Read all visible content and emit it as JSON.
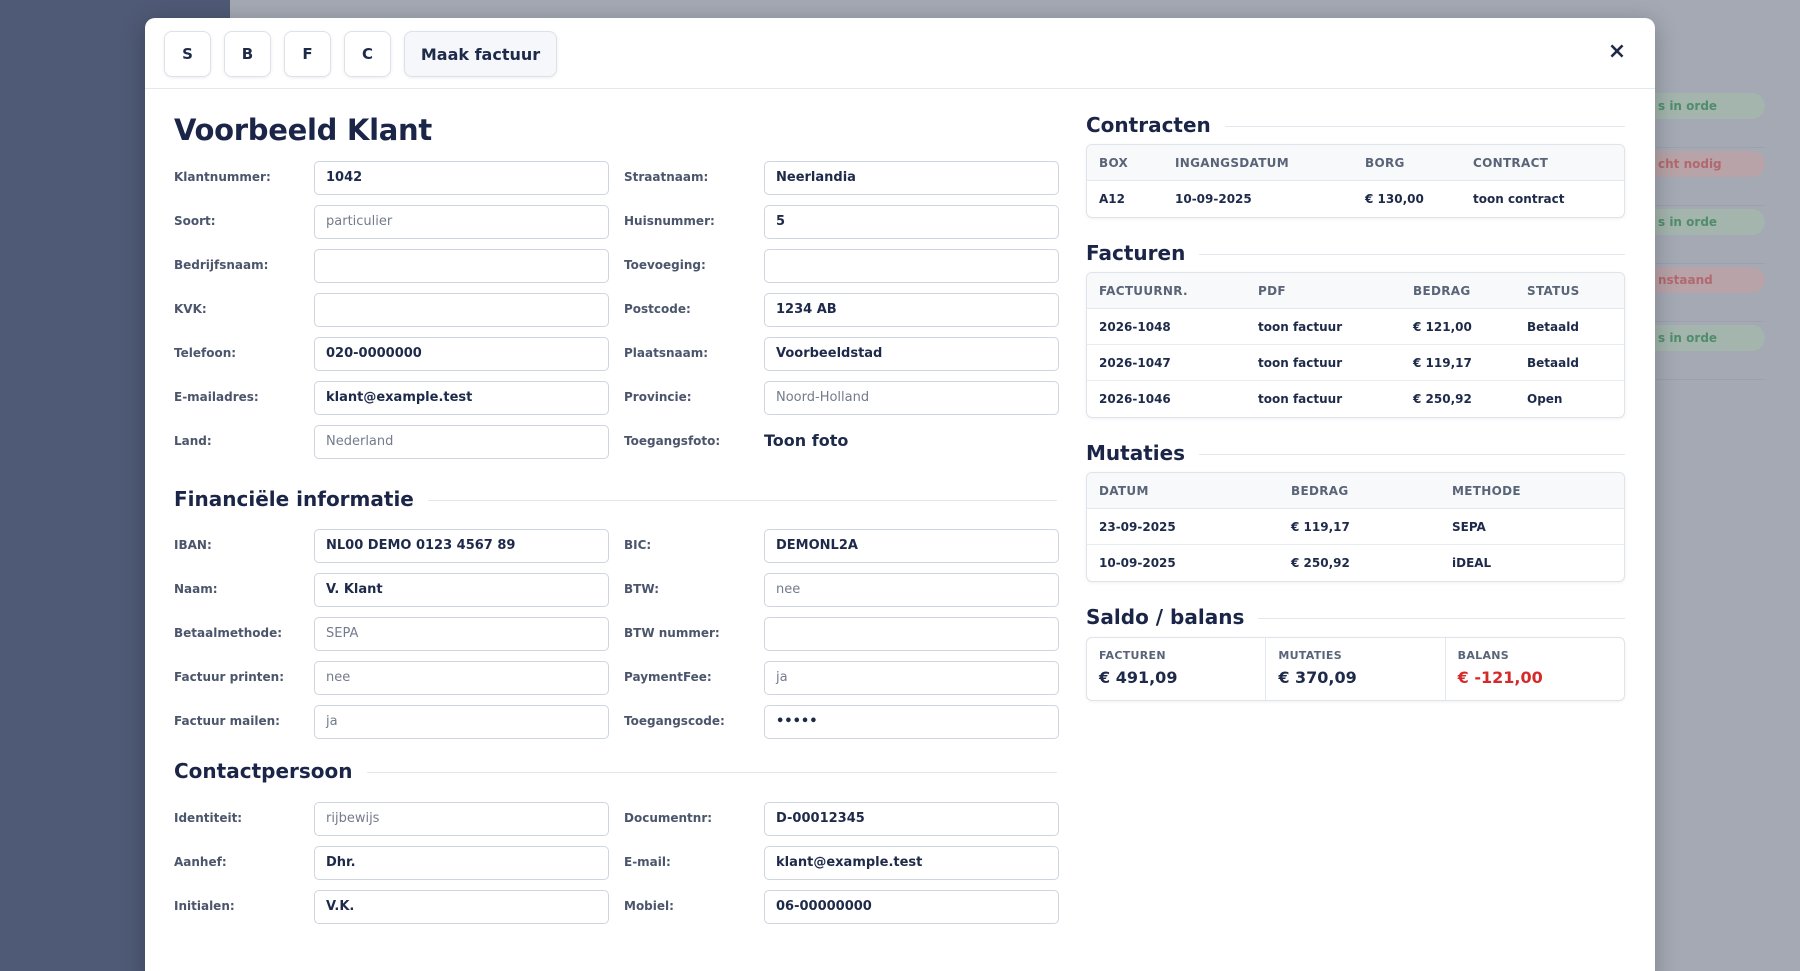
{
  "background": {
    "status_pills": [
      {
        "text": "s in orde",
        "status": "green"
      },
      {
        "text": "cht nodig",
        "status": "red"
      },
      {
        "text": "s in orde",
        "status": "green"
      },
      {
        "text": "nstaand",
        "status": "red"
      },
      {
        "text": "s in orde",
        "status": "green"
      }
    ]
  },
  "toolbar": {
    "buttons": [
      "S",
      "B",
      "F",
      "C"
    ],
    "invoice_button": "Maak factuur",
    "close": "×"
  },
  "customer": {
    "name": "Voorbeeld Klant",
    "fields_left": [
      {
        "label": "Klantnummer:",
        "value": "1042",
        "placeholder": false
      },
      {
        "label": "Soort:",
        "value": "particulier",
        "placeholder": true
      },
      {
        "label": "Bedrijfsnaam:",
        "value": "",
        "placeholder": false
      },
      {
        "label": "KVK:",
        "value": "",
        "placeholder": false
      },
      {
        "label": "Telefoon:",
        "value": "020-0000000",
        "placeholder": false
      },
      {
        "label": "E-mailadres:",
        "value": "klant@example.test",
        "placeholder": false
      },
      {
        "label": "Land:",
        "value": "Nederland",
        "placeholder": true
      }
    ],
    "fields_right": [
      {
        "label": "Straatnaam:",
        "value": "Neerlandia",
        "placeholder": false
      },
      {
        "label": "Huisnummer:",
        "value": "5",
        "placeholder": false
      },
      {
        "label": "Toevoeging:",
        "value": "",
        "placeholder": false
      },
      {
        "label": "Postcode:",
        "value": "1234 AB",
        "placeholder": false
      },
      {
        "label": "Plaatsnaam:",
        "value": "Voorbeeldstad",
        "placeholder": false
      },
      {
        "label": "Provincie:",
        "value": "Noord-Holland",
        "placeholder": true
      },
      {
        "label": "Toegangsfoto:",
        "value": "Toon foto",
        "plain": true
      }
    ]
  },
  "financial": {
    "title": "Financiële informatie",
    "fields_left": [
      {
        "label": "IBAN:",
        "value": "NL00 DEMO 0123 4567 89",
        "placeholder": false
      },
      {
        "label": "Naam:",
        "value": "V. Klant",
        "placeholder": false
      },
      {
        "label": "Betaalmethode:",
        "value": "SEPA",
        "placeholder": true
      },
      {
        "label": "Factuur printen:",
        "value": "nee",
        "placeholder": true
      },
      {
        "label": "Factuur mailen:",
        "value": "ja",
        "placeholder": true
      }
    ],
    "fields_right": [
      {
        "label": "BIC:",
        "value": "DEMONL2A",
        "placeholder": false
      },
      {
        "label": "BTW:",
        "value": "nee",
        "placeholder": true
      },
      {
        "label": "BTW nummer:",
        "value": "",
        "placeholder": false
      },
      {
        "label": "PaymentFee:",
        "value": "ja",
        "placeholder": true
      },
      {
        "label": "Toegangscode:",
        "value": "•••••",
        "placeholder": false
      }
    ]
  },
  "contact": {
    "title": "Contactpersoon",
    "fields_left": [
      {
        "label": "Identiteit:",
        "value": "rijbewijs",
        "placeholder": true
      },
      {
        "label": "Aanhef:",
        "value": "Dhr.",
        "placeholder": false
      },
      {
        "label": "Initialen:",
        "value": "V.K.",
        "placeholder": false
      }
    ],
    "fields_right": [
      {
        "label": "Documentnr:",
        "value": "D-00012345",
        "placeholder": false
      },
      {
        "label": "E-mail:",
        "value": "klant@example.test",
        "placeholder": false
      },
      {
        "label": "Mobiel:",
        "value": "06-00000000",
        "placeholder": false
      }
    ]
  },
  "contracts": {
    "title": "Contracten",
    "columns": [
      "BOX",
      "INGANGSDATUM",
      "BORG",
      "CONTRACT"
    ],
    "rows": [
      [
        "A12",
        "10-09-2025",
        "€ 130,00",
        "toon contract"
      ]
    ]
  },
  "invoices": {
    "title": "Facturen",
    "columns": [
      "FACTUURNR.",
      "PDF",
      "BEDRAG",
      "STATUS"
    ],
    "rows": [
      [
        "2026-1048",
        "toon factuur",
        "€ 121,00",
        "Betaald"
      ],
      [
        "2026-1047",
        "toon factuur",
        "€ 119,17",
        "Betaald"
      ],
      [
        "2026-1046",
        "toon factuur",
        "€ 250,92",
        "Open"
      ]
    ]
  },
  "mutations": {
    "title": "Mutaties",
    "columns": [
      "DATUM",
      "BEDRAG",
      "METHODE"
    ],
    "rows": [
      [
        "23-09-2025",
        "€ 119,17",
        "SEPA"
      ],
      [
        "10-09-2025",
        "€ 250,92",
        "iDEAL"
      ]
    ]
  },
  "balance": {
    "title": "Saldo / balans",
    "cells": [
      {
        "label": "FACTUREN",
        "value": "€ 491,09",
        "negative": false
      },
      {
        "label": "MUTATIES",
        "value": "€ 370,09",
        "negative": false
      },
      {
        "label": "BALANS",
        "value": "€ -121,00",
        "negative": true
      }
    ],
    "negative_color": "#d42a2a"
  }
}
